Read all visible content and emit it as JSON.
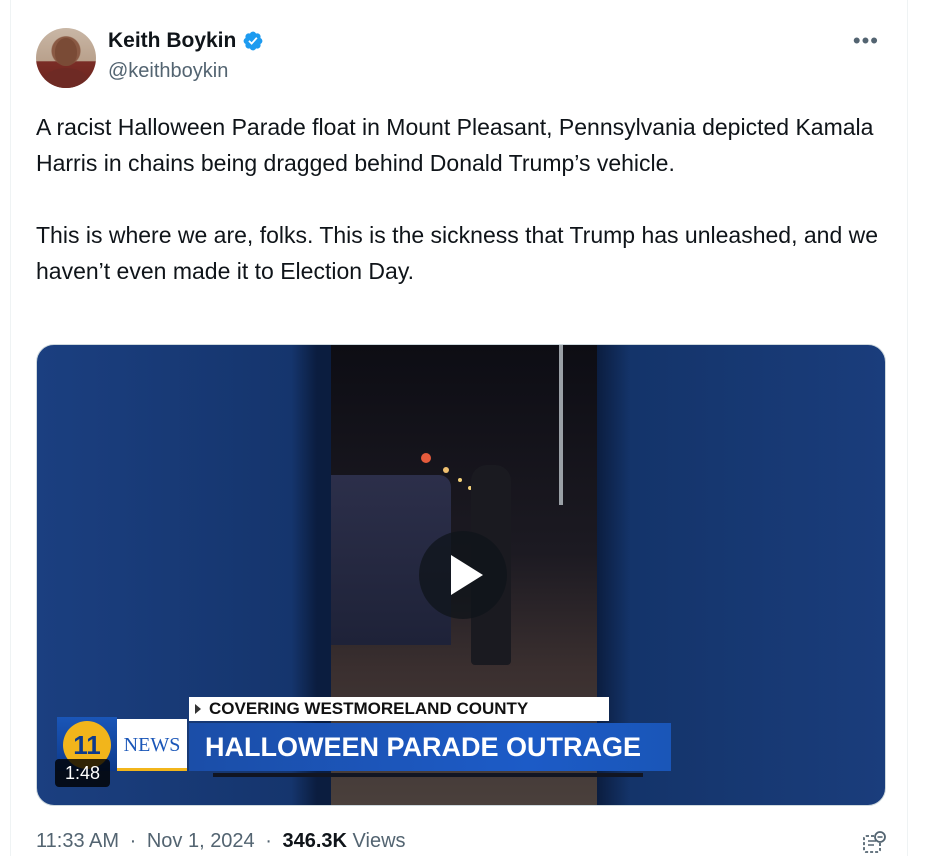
{
  "author": {
    "display_name": "Keith Boykin",
    "handle": "@keithboykin",
    "verified": true
  },
  "tweet": {
    "paragraphs": [
      "A racist Halloween Parade float in Mount Pleasant, Pennsylvania depicted Kamala Harris in chains being dragged behind Donald Trump’s vehicle.",
      "This is where we are, folks. This is the sickness that Trump has unleashed, and we haven’t even made it to Election Day."
    ]
  },
  "media": {
    "type": "video",
    "duration": "1:48",
    "lower_third_top": "COVERING WESTMORELAND COUNTY",
    "lower_third_main": "HALLOWEEN PARADE OUTRAGE",
    "news_label": "NEWS",
    "logo_text": "11"
  },
  "meta": {
    "time": "11:33 AM",
    "separator": "·",
    "date": "Nov 1, 2024",
    "views_count": "346.3K",
    "views_label": "Views"
  },
  "icons": {
    "more": "more-options-icon",
    "verified": "verified-badge-icon",
    "play": "play-icon",
    "grok": "grok-icon"
  },
  "colors": {
    "verified_blue": "#1d9bf0",
    "text_primary": "#0f1419",
    "text_secondary": "#536471"
  }
}
